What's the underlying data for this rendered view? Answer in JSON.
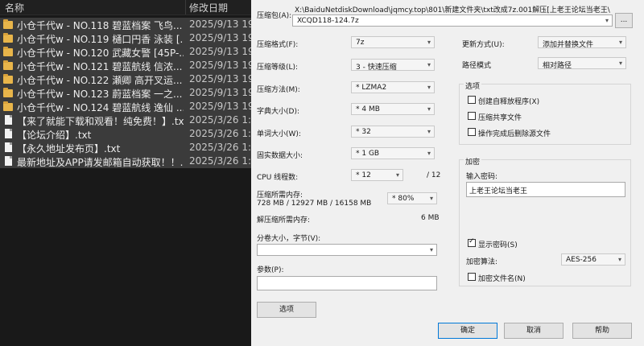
{
  "explorer": {
    "col_name": "名称",
    "col_modified": "修改日期",
    "files": [
      {
        "type": "folder",
        "name": "小仓千代w - NO.118 碧蓝档案 飞鸟...",
        "date": "2025/9/13 19",
        "selected": true
      },
      {
        "type": "folder",
        "name": "小仓千代w - NO.119 樋口円香 泳装 [...",
        "date": "2025/9/13 19",
        "selected": true
      },
      {
        "type": "folder",
        "name": "小仓千代w - NO.120 武藏女警 [45P-...",
        "date": "2025/9/13 19",
        "selected": true
      },
      {
        "type": "folder",
        "name": "小仓千代w - NO.121 碧蓝航线 信浓...",
        "date": "2025/9/13 19",
        "selected": true
      },
      {
        "type": "folder",
        "name": "小仓千代w - NO.122 瀬卿 高开叉运...",
        "date": "2025/9/13 19",
        "selected": true
      },
      {
        "type": "folder",
        "name": "小仓千代w - NO.123 蔚蓝档案 一之...",
        "date": "2025/9/13 19",
        "selected": true
      },
      {
        "type": "folder",
        "name": "小仓千代w - NO.124 碧蓝航线 逸仙 ...",
        "date": "2025/9/13 19",
        "selected": true
      },
      {
        "type": "txt",
        "name": "【来了就能下载和观看！纯免费！】.txt",
        "date": "2025/3/26 1:0",
        "selected": true
      },
      {
        "type": "txt",
        "name": "【论坛介绍】.txt",
        "date": "2025/3/26 1:0",
        "selected": true
      },
      {
        "type": "txt",
        "name": "【永久地址发布页】.txt",
        "date": "2025/3/26 1:0",
        "selected": true
      },
      {
        "type": "txt",
        "name": "最新地址及APP请发邮箱自动获取！！...",
        "date": "2025/3/26 1:0",
        "selected": true
      }
    ]
  },
  "dialog": {
    "archive_label": "压缩包(A):",
    "archive_path": "X:\\BaiduNetdiskDownload\\jqmcy.top\\801\\新建文件夹\\txt改成7z.001解压[上老王论坛当老王\\",
    "archive_name": "XCQD118-124.7z",
    "browse_label": "...",
    "format_label": "压缩格式(F):",
    "format_value": "7z",
    "level_label": "压缩等级(L):",
    "level_value": "3 - 快速压缩",
    "method_label": "压缩方法(M):",
    "method_value": "* LZMA2",
    "dict_label": "字典大小(D):",
    "dict_value": "* 4 MB",
    "word_label": "单词大小(W):",
    "word_value": "* 32",
    "solid_label": "固实数据大小:",
    "solid_value": "* 1 GB",
    "threads_label": "CPU 线程数:",
    "threads_value": "* 12",
    "threads_total": "/ 12",
    "mem_comp_label": "压缩所需内存:",
    "mem_comp_detail": "728 MB / 12927 MB / 16158 MB",
    "mem_percent": "* 80%",
    "mem_decomp_label": "解压缩所需内存:",
    "mem_decomp_value": "6 MB",
    "split_label": "分卷大小，字节(V):",
    "split_value": "",
    "params_label": "参数(P):",
    "params_value": "",
    "options_button": "选项",
    "update_label": "更新方式(U):",
    "update_value": "添加并替换文件",
    "path_mode_label": "路径模式",
    "path_mode_value": "相对路径",
    "options_group": "选项",
    "opt_sfx": "创建自释放程序(X)",
    "opt_shared": "压缩共享文件",
    "opt_delete": "操作完成后删除源文件",
    "encrypt_group": "加密",
    "password_label": "输入密码:",
    "password_value": "上老王论坛当老王",
    "show_password": "显示密码(S)",
    "enc_method_label": "加密算法:",
    "enc_method_value": "AES-256",
    "encrypt_names": "加密文件名(N)",
    "ok_button": "确定",
    "cancel_button": "取消",
    "help_button": "帮助"
  }
}
